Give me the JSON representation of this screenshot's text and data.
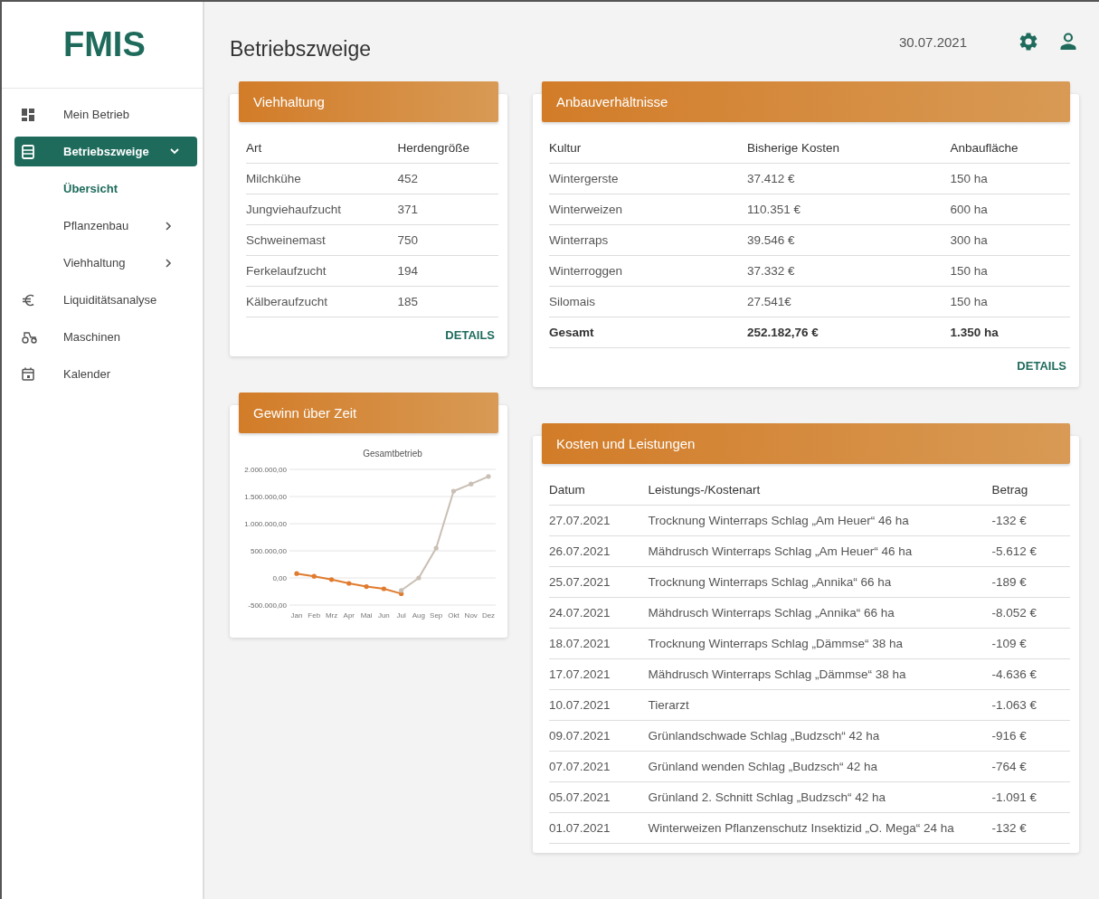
{
  "sidebar": {
    "logo": "FMIS",
    "items": [
      {
        "label": "Mein Betrieb",
        "selected": false
      },
      {
        "label": "Betriebszweige",
        "selected": true,
        "expanded": true,
        "children": [
          {
            "label": "Übersicht",
            "selected": true,
            "has_submenu": false
          },
          {
            "label": "Pflanzenbau",
            "selected": false,
            "has_submenu": true
          },
          {
            "label": "Viehhaltung",
            "selected": false,
            "has_submenu": true
          }
        ]
      },
      {
        "label": "Liquiditätsanalyse",
        "selected": false
      },
      {
        "label": "Maschinen",
        "selected": false
      },
      {
        "label": "Kalender",
        "selected": false
      }
    ]
  },
  "header": {
    "title": "Betriebszweige",
    "date": "30.07.2021"
  },
  "livestock": {
    "title": "Viehhaltung",
    "columns": [
      "Art",
      "Herdengröße"
    ],
    "rows": [
      [
        "Milchkühe",
        "452"
      ],
      [
        "Jungviehaufzucht",
        "371"
      ],
      [
        "Schweinemast",
        "750"
      ],
      [
        "Ferkelaufzucht",
        "194"
      ],
      [
        "Kälberaufzucht",
        "185"
      ]
    ],
    "link": "DETAILS"
  },
  "profit": {
    "title": "Gewinn über Zeit",
    "chart_data": {
      "type": "line",
      "title": "Gesamtbetrieb",
      "categories": [
        "Jan",
        "Feb",
        "Mrz",
        "Apr",
        "Mai",
        "Jun",
        "Jul",
        "Aug",
        "Sep",
        "Okt",
        "Nov",
        "Dez"
      ],
      "series": [
        {
          "color": "#e07b2e",
          "values": [
            80000,
            30000,
            -30000,
            -100000,
            -160000,
            -200000,
            -290000,
            null,
            null,
            null,
            null,
            null
          ]
        },
        {
          "color": "#c9bfb4",
          "values": [
            null,
            null,
            null,
            null,
            null,
            null,
            -230000,
            0,
            550000,
            1600000,
            1730000,
            1870000
          ]
        }
      ],
      "ylim": [
        -500000,
        2000000
      ],
      "grid": true,
      "yticks": [
        {
          "value": -500000,
          "label": "-500.000,00"
        },
        {
          "value": 0,
          "label": "0,00"
        },
        {
          "value": 500000,
          "label": "500.000,00"
        },
        {
          "value": 1000000,
          "label": "1.000.000,00"
        },
        {
          "value": 1500000,
          "label": "1.500.000,00"
        },
        {
          "value": 2000000,
          "label": "2.000.000,00"
        }
      ]
    }
  },
  "crops": {
    "title": "Anbauverhältnisse",
    "columns": [
      "Kultur",
      "Bisherige Kosten",
      "Anbaufläche"
    ],
    "rows": [
      [
        "Wintergerste",
        "37.412 €",
        "150 ha"
      ],
      [
        "Winterweizen",
        "110.351 €",
        "600 ha"
      ],
      [
        "Winterraps",
        "39.546 €",
        "300 ha"
      ],
      [
        "Winterroggen",
        "37.332 €",
        "150 ha"
      ],
      [
        "Silomais",
        "27.541€",
        "150 ha"
      ]
    ],
    "total": [
      "Gesamt",
      "252.182,76 €",
      "1.350 ha"
    ],
    "link": "DETAILS"
  },
  "costs": {
    "title": "Kosten und Leistungen",
    "columns": [
      "Datum",
      "Leistungs-/Kostenart",
      "Betrag"
    ],
    "rows": [
      [
        "27.07.2021",
        "Trocknung Winterraps Schlag „Am Heuer“ 46 ha",
        "-132 €"
      ],
      [
        "26.07.2021",
        "Mähdrusch Winterraps Schlag „Am Heuer“ 46 ha",
        "-5.612 €"
      ],
      [
        "25.07.2021",
        "Trocknung Winterraps Schlag „Annika“ 66 ha",
        "-189 €"
      ],
      [
        "24.07.2021",
        "Mähdrusch Winterraps Schlag „Annika“ 66 ha",
        "-8.052 €"
      ],
      [
        "18.07.2021",
        "Trocknung Winterraps Schlag „Dämmse“ 38 ha",
        "-109 €"
      ],
      [
        "17.07.2021",
        "Mähdrusch Winterraps Schlag „Dämmse“ 38 ha",
        "-4.636 €"
      ],
      [
        "10.07.2021",
        "Tierarzt",
        "-1.063 €"
      ],
      [
        "09.07.2021",
        "Grünlandschwade Schlag „Budzsch“ 42 ha",
        "-916 €"
      ],
      [
        "07.07.2021",
        "Grünland wenden Schlag „Budzsch“ 42 ha",
        "-764 €"
      ],
      [
        "05.07.2021",
        "Grünland 2. Schnitt Schlag „Budzsch“ 42 ha",
        "-1.091 €"
      ],
      [
        "01.07.2021",
        "Winterweizen Pflanzenschutz Insektizid „O. Mega“ 24 ha",
        "-132 €"
      ]
    ]
  }
}
